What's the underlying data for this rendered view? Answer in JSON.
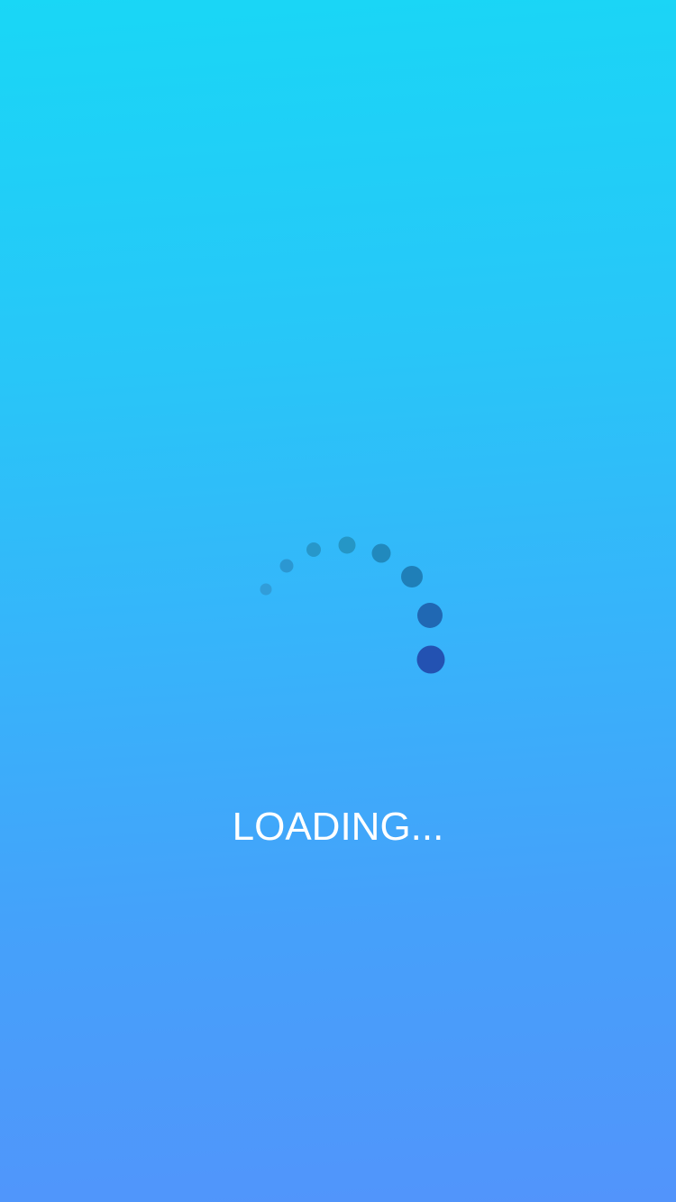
{
  "screen": {
    "loading_text": "LOADING...",
    "background_colors": [
      "#19d7f6",
      "#38b2fa",
      "#5294fb"
    ],
    "spinner_colors": [
      "#2f8fc7",
      "#2a8cc4",
      "#2690c2",
      "#2492c0",
      "#2189bd",
      "#1f7fb8",
      "#2068b3",
      "#2352b2"
    ],
    "text_color": "#ffffff"
  }
}
